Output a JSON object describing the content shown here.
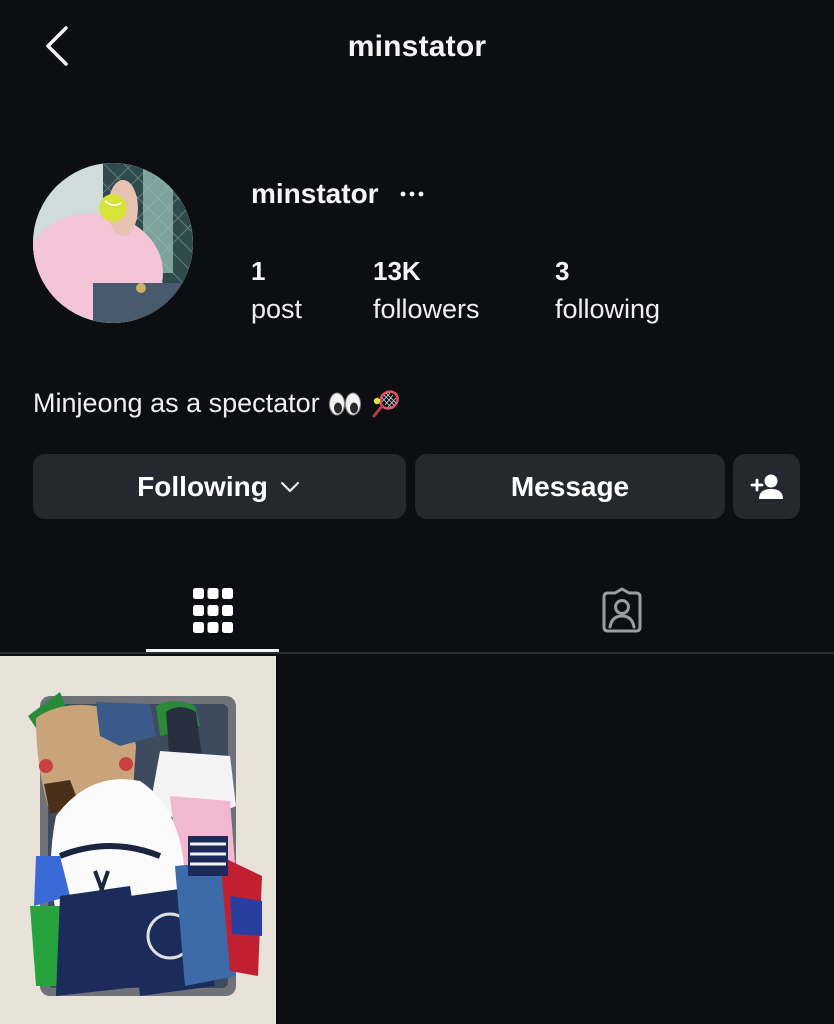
{
  "header": {
    "title": "minstator",
    "back_icon": "chevron-left-icon"
  },
  "profile": {
    "username": "minstator",
    "more_icon": "more-horizontal-icon",
    "stats": {
      "posts_value": "1",
      "posts_label": "post",
      "followers_value": "13K",
      "followers_label": "followers",
      "following_value": "3",
      "following_label": "following"
    },
    "bio": "Minjeong as a spectator",
    "bio_emojis": [
      "eyes-emoji",
      "tennis-emoji"
    ]
  },
  "actions": {
    "following_label": "Following",
    "message_label": "Message",
    "add_user_icon": "add-user-icon"
  },
  "tabs": [
    {
      "icon": "grid-icon",
      "active": true
    },
    {
      "icon": "tagged-icon",
      "active": false
    }
  ],
  "colors": {
    "background": "#0c0e12",
    "button": "#25282e",
    "text": "#f5f5f5"
  }
}
